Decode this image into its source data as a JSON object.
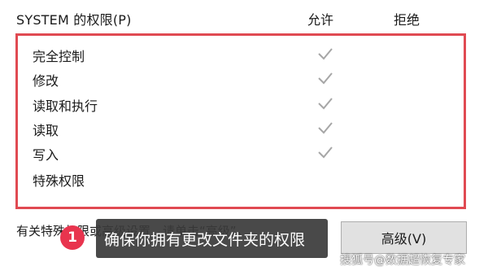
{
  "permissions_header": {
    "title": "SYSTEM 的权限(P)",
    "allow_label": "允许",
    "deny_label": "拒绝"
  },
  "permissions": [
    {
      "name": "完全控制",
      "allow": true,
      "deny": false
    },
    {
      "name": "修改",
      "allow": true,
      "deny": false
    },
    {
      "name": "读取和执行",
      "allow": true,
      "deny": false
    },
    {
      "name": "读取",
      "allow": true,
      "deny": false
    },
    {
      "name": "写入",
      "allow": true,
      "deny": false
    },
    {
      "name": "特殊权限",
      "allow": false,
      "deny": false
    }
  ],
  "note_text": "有关特殊权限或高级设置，请单击“高级”。",
  "advanced_button_label": "高级(V)",
  "tip": {
    "step": "1",
    "text": "确保你拥有更改文件夹的权限"
  },
  "watermark": "搜狐号@数据超恢复专家",
  "colors": {
    "highlight_border": "#e04a52",
    "check_gray": "#a6a6a6",
    "badge_red": "#e8344e",
    "tip_background": "#3a3a3a"
  },
  "icons": {
    "check": "checkmark-icon"
  }
}
